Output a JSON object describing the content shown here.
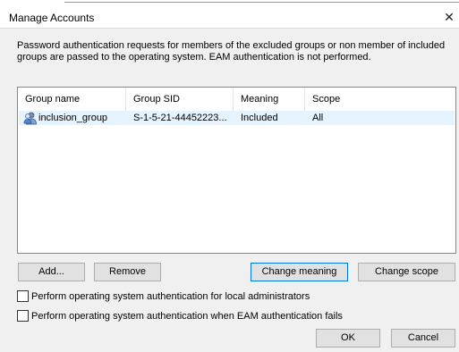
{
  "window": {
    "title": "Manage Accounts",
    "close_glyph": "✕"
  },
  "description": "Password authentication requests for members of the excluded groups or non member of included groups are passed to the operating system.  EAM authentication is not performed.",
  "table": {
    "columns": [
      "Group name",
      "Group SID",
      "Meaning",
      "Scope"
    ],
    "rows": [
      {
        "icon": "group-user-icon",
        "group_name": "inclusion_group",
        "group_sid": "S-1-5-21-44452223...",
        "meaning": "Included",
        "scope": "All"
      }
    ],
    "selected_row_color": "#e5f3ff"
  },
  "buttons": {
    "add": "Add...",
    "remove": "Remove",
    "change_meaning": "Change meaning",
    "change_scope": "Change scope",
    "ok": "OK",
    "cancel": "Cancel"
  },
  "options": {
    "local_admins_label": "Perform operating system authentication for local administrators",
    "local_admins_checked": false,
    "eam_fail_label": "Perform operating system authentication when EAM authentication fails",
    "eam_fail_checked": false
  },
  "colors": {
    "accent": "#0078d7",
    "button_bg": "#e1e1e1",
    "dialog_bg": "#f0f0f0"
  }
}
